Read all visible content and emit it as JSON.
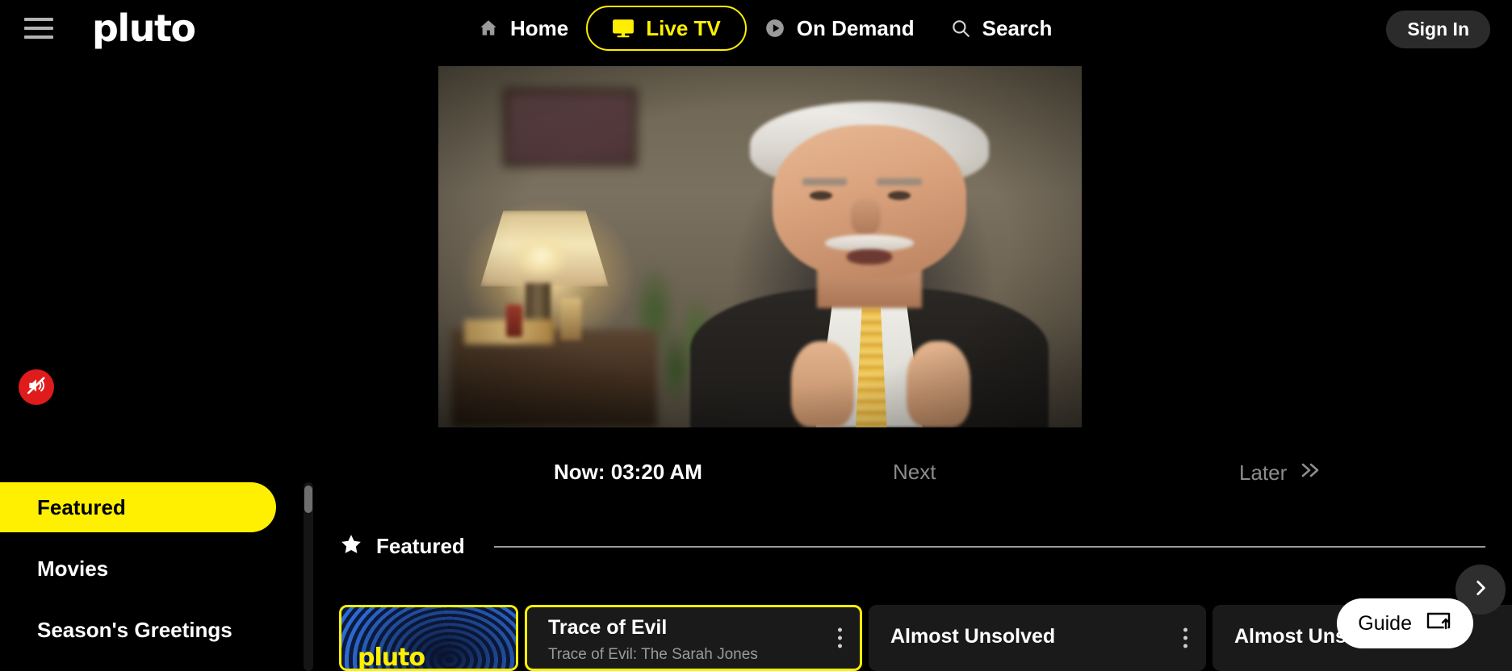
{
  "header": {
    "menu_icon": "hamburger-menu-icon",
    "brand": "pluto",
    "nav": [
      {
        "label": "Home",
        "icon": "home-icon",
        "active": false
      },
      {
        "label": "Live TV",
        "icon": "tv-icon",
        "active": true
      },
      {
        "label": "On Demand",
        "icon": "play-circle-icon",
        "active": false
      },
      {
        "label": "Search",
        "icon": "search-icon",
        "active": false
      }
    ],
    "sign_in_label": "Sign In"
  },
  "player": {
    "mute_icon": "muted-speaker-icon",
    "muted": true
  },
  "timeline": {
    "now_label": "Now: 03:20 AM",
    "next_label": "Next",
    "later_label": "Later",
    "later_icon": "double-chevron-right-icon"
  },
  "sidebar": {
    "items": [
      {
        "label": "Featured",
        "active": true
      },
      {
        "label": "Movies",
        "active": false
      },
      {
        "label": "Season's Greetings",
        "active": false
      }
    ]
  },
  "section": {
    "star_icon": "star-icon",
    "title": "Featured"
  },
  "rail": {
    "cards": [
      {
        "type": "thumbnail",
        "logo": "pluto",
        "selected": true
      },
      {
        "type": "info",
        "title": "Trace of Evil",
        "subtitle": "Trace of Evil: The Sarah Jones",
        "selected": true,
        "menu_icon": "kebab-menu-icon"
      },
      {
        "type": "info",
        "title": "Almost Unsolved",
        "subtitle": "",
        "selected": false,
        "menu_icon": "kebab-menu-icon"
      },
      {
        "type": "info",
        "title": "Almost Unsolved",
        "subtitle": "",
        "selected": false,
        "menu_icon": "kebab-menu-icon"
      }
    ],
    "next_icon": "chevron-right-icon"
  },
  "guide": {
    "label": "Guide",
    "icon": "screen-expand-up-icon"
  },
  "colors": {
    "accent_yellow": "#ffef00",
    "background": "#000000",
    "mute_red": "#e01b1b",
    "muted_text": "#8c8c8c"
  }
}
